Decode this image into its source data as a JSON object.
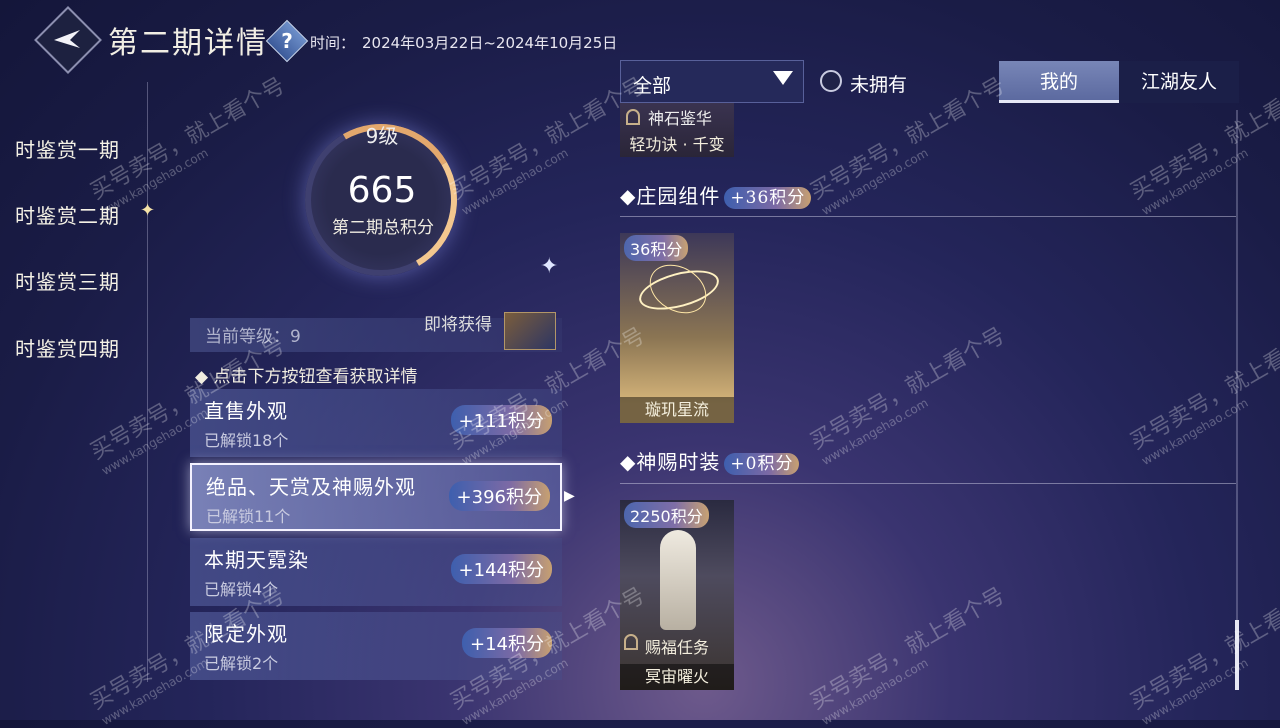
{
  "header": {
    "title": "第二期详情",
    "help_symbol": "?",
    "time_label": "时间：",
    "time_value": "2024年03月22日~2024年10月25日"
  },
  "sidebar": {
    "items": [
      {
        "label": "时鉴赏一期"
      },
      {
        "label": "时鉴赏二期"
      },
      {
        "label": "时鉴赏三期"
      },
      {
        "label": "时鉴赏四期"
      }
    ]
  },
  "score": {
    "level": "9级",
    "total": "665",
    "label": "第二期总积分"
  },
  "current": {
    "level_text": "当前等级：9",
    "right_text": "即将获得"
  },
  "hint": "点击下方按钮查看获取详情",
  "categories": [
    {
      "title": "直售外观",
      "sub": "已解锁18个",
      "points": "+111积分"
    },
    {
      "title": "绝品、天赏及神赐外观",
      "sub": "已解锁11个",
      "points": "+396积分"
    },
    {
      "title": "本期天霓染",
      "sub": "已解锁4个",
      "points": "+144积分"
    },
    {
      "title": "限定外观",
      "sub": "已解锁2个",
      "points": "+14积分"
    }
  ],
  "filters": {
    "dropdown": "全部",
    "radio_label": "未拥有",
    "tab_mine": "我的",
    "tab_friends": "江湖友人"
  },
  "list": {
    "top_item": {
      "name1": "神石鉴华",
      "name2": "轻功诀 · 千变"
    },
    "section1": {
      "title": "庄园组件",
      "points": "+36积分",
      "item": {
        "cost": "36积分",
        "name": "璇玑星流"
      }
    },
    "section2": {
      "title": "神赐时装",
      "points": "+0积分",
      "item": {
        "cost": "2250积分",
        "task": "赐福任务",
        "name": "冥宙曜火"
      }
    }
  },
  "watermark": {
    "line1": "买号卖号，就上看个号",
    "line2": "www.kangehao.com"
  }
}
